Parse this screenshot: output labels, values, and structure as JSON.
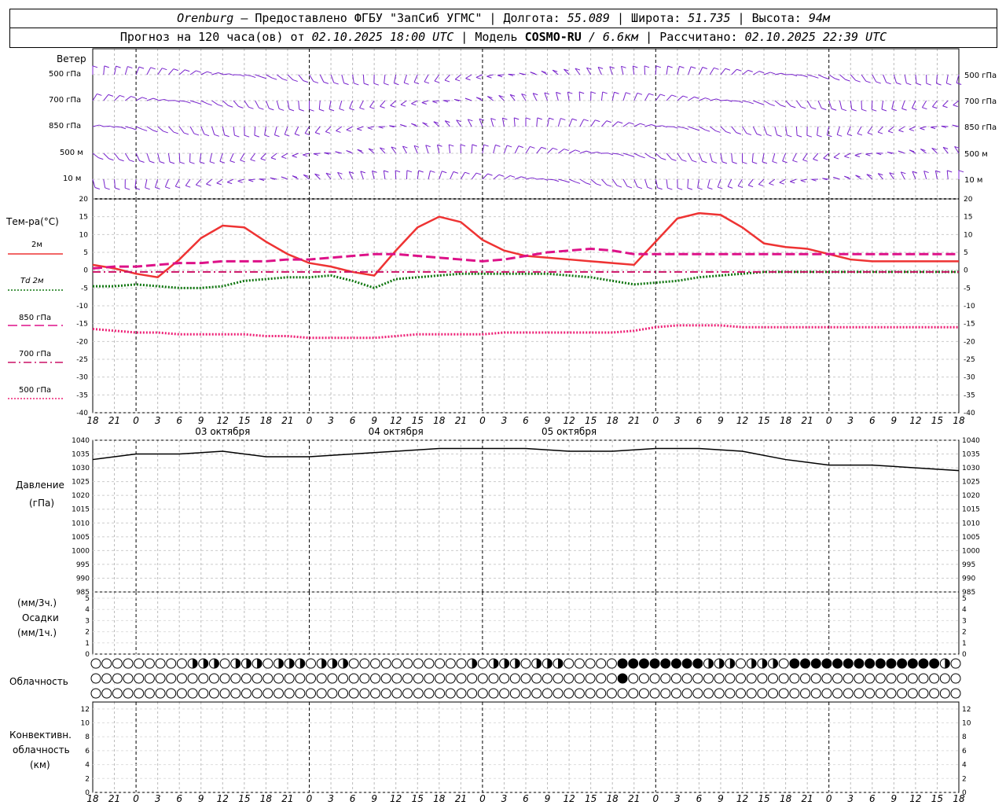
{
  "header": {
    "station": "Orenburg",
    "provider": "— Предоставлено ФГБУ \"ЗапСиб УГМС\"",
    "lon_label": "Долгота:",
    "lon": "55.089",
    "lat_label": "Широта:",
    "lat": "51.735",
    "alt_label": "Высота:",
    "alt": "94м",
    "forecast_label": "Прогноз на 120 часа(ов) от",
    "forecast_start": "02.10.2025 18:00 UTC",
    "model_label": "Модель",
    "model_name": "COSMO-RU",
    "model_res": "/ 6.6км",
    "computed_label": "Рассчитано:",
    "computed_at": "02.10.2025 22:39 UTC"
  },
  "wind_panel": {
    "title": "Ветер",
    "levels": [
      "500 гПа",
      "700 гПа",
      "850 гПа",
      "500 м",
      "10 м"
    ]
  },
  "temp_panel": {
    "title": "Тем-ра(°C)",
    "legend": [
      {
        "label": "2м",
        "color": "#ee3333",
        "style": "solid"
      },
      {
        "label": "Td 2м",
        "color": "#117711",
        "style": "dotted"
      },
      {
        "label": "850 гПа",
        "color": "#dd1188",
        "style": "dashed"
      },
      {
        "label": "700 гПа",
        "color": "#cc1166",
        "style": "dashdot"
      },
      {
        "label": "500 гПа",
        "color": "#ee2277",
        "style": "dotted"
      }
    ]
  },
  "pressure_panel": {
    "title": "Давление",
    "unit": "(гПа)"
  },
  "precip_panel": {
    "unit_top": "(мм/3ч.)",
    "title": "Осадки",
    "unit_bottom": "(мм/1ч.)"
  },
  "cloud_panel": {
    "title": "Облачность"
  },
  "conv_panel": {
    "line1": "Конвективн.",
    "line2": "облачность",
    "line3": "(км)"
  },
  "time_axis": {
    "hour_labels": [
      "18",
      "21",
      "0",
      "3",
      "6",
      "9",
      "12",
      "15",
      "18",
      "21",
      "0",
      "3",
      "6",
      "9",
      "12",
      "15",
      "18",
      "21",
      "0",
      "3",
      "6",
      "9",
      "12",
      "15",
      "18",
      "21",
      "0"
    ],
    "date_labels": [
      "03 октября",
      "04 октября",
      "05 октября"
    ]
  },
  "chart_data": [
    {
      "type": "line",
      "title": "Тем-ра(°C)",
      "x": [
        0,
        3,
        6,
        9,
        12,
        15,
        18,
        21,
        24,
        27,
        30,
        33,
        36,
        39,
        42,
        45,
        48,
        51,
        54,
        57,
        60,
        63,
        66,
        69,
        72,
        75,
        78,
        81,
        84,
        87,
        90,
        93,
        96,
        99,
        102,
        105,
        108,
        111,
        114,
        117,
        120
      ],
      "ylim": [
        -40,
        20
      ],
      "yticks": [
        20,
        15,
        10,
        5,
        0,
        -5,
        -10,
        -15,
        -20,
        -25,
        -30,
        -35,
        -40
      ],
      "series": [
        {
          "name": "2м",
          "color": "#ee3333",
          "values": [
            1.5,
            0.5,
            -1,
            -2,
            3,
            9,
            12.5,
            12,
            8,
            4.5,
            2,
            1,
            -0.5,
            -1.5,
            5.5,
            12,
            15,
            13.5,
            8.5,
            5.5,
            4,
            3.5,
            3,
            2.5,
            2,
            1.5,
            8,
            14.5,
            16,
            15.5,
            12,
            7.5,
            6.5,
            6,
            4.5,
            3,
            2.5,
            2.5,
            2.5,
            2.5,
            2.5
          ]
        },
        {
          "name": "Td 2м",
          "color": "#117711",
          "values": [
            -4.5,
            -4.5,
            -4,
            -4.5,
            -5,
            -5,
            -4.5,
            -3,
            -2.5,
            -2,
            -2,
            -1.5,
            -3,
            -5,
            -2.5,
            -2,
            -1.5,
            -1,
            -1,
            -1,
            -1,
            -1,
            -1.5,
            -2,
            -3,
            -4,
            -3.5,
            -3,
            -2,
            -1.5,
            -1,
            -0.5,
            -0.5,
            -0.5,
            -0.5,
            -0.5,
            -0.5,
            -0.5,
            -0.5,
            -0.5,
            -0.5
          ]
        },
        {
          "name": "850 гПа",
          "color": "#dd1188",
          "values": [
            0.5,
            1,
            1,
            1.5,
            2,
            2,
            2.5,
            2.5,
            2.5,
            3,
            3,
            3.5,
            4,
            4.5,
            4.5,
            4,
            3.5,
            3,
            2.5,
            3,
            4,
            5,
            5.5,
            6,
            5.5,
            4.5,
            4.5,
            4.5,
            4.5,
            4.5,
            4.5,
            4.5,
            4.5,
            4.5,
            4.5,
            4.5,
            4.5,
            4.5,
            4.5,
            4.5,
            4.5
          ]
        },
        {
          "name": "700 гПа",
          "color": "#cc1166",
          "values": [
            -0.5,
            -0.5,
            -0.5,
            -0.5,
            -0.5,
            -0.5,
            -0.5,
            -0.5,
            -0.5,
            -0.5,
            -0.5,
            -0.5,
            -0.5,
            -0.5,
            -0.5,
            -0.5,
            -0.5,
            -0.5,
            -0.5,
            -0.5,
            -0.5,
            -0.5,
            -0.5,
            -0.5,
            -0.5,
            -0.5,
            -0.5,
            -0.5,
            -0.5,
            -0.5,
            -0.5,
            -0.5,
            -0.5,
            -0.5,
            -0.5,
            -0.5,
            -0.5,
            -0.5,
            -0.5,
            -0.5,
            -0.5
          ]
        },
        {
          "name": "500 гПа",
          "color": "#ee2277",
          "values": [
            -16.5,
            -17,
            -17.5,
            -17.5,
            -18,
            -18,
            -18,
            -18,
            -18.5,
            -18.5,
            -19,
            -19,
            -19,
            -19,
            -18.5,
            -18,
            -18,
            -18,
            -18,
            -17.5,
            -17.5,
            -17.5,
            -17.5,
            -17.5,
            -17.5,
            -17,
            -16,
            -15.5,
            -15.5,
            -15.5,
            -16,
            -16,
            -16,
            -16,
            -16,
            -16,
            -16,
            -16,
            -16,
            -16,
            -16
          ]
        }
      ]
    },
    {
      "type": "line",
      "title": "Давление",
      "x": [
        0,
        6,
        12,
        18,
        24,
        30,
        36,
        42,
        48,
        54,
        60,
        66,
        72,
        78,
        84,
        90,
        96,
        102,
        108,
        114,
        120
      ],
      "ylim": [
        985,
        1040
      ],
      "yticks": [
        1040,
        1035,
        1030,
        1025,
        1020,
        1015,
        1010,
        1005,
        1000,
        995,
        990,
        985
      ],
      "series": [
        {
          "name": "Давление",
          "color": "#000000",
          "values": [
            1033,
            1035,
            1035,
            1036,
            1034,
            1034,
            1035,
            1036,
            1037,
            1037,
            1037,
            1036,
            1036,
            1037,
            1037,
            1036,
            1033,
            1031,
            1031,
            1030,
            1029
          ]
        }
      ]
    },
    {
      "type": "bar",
      "title": "Осадки",
      "ylim": [
        0,
        5
      ],
      "yticks": [
        5,
        4,
        3,
        2,
        1,
        0
      ],
      "values": []
    },
    {
      "type": "bar",
      "title": "Конвективн. облачность",
      "ylim": [
        0,
        13
      ],
      "yticks": [
        12,
        10,
        8,
        6,
        4,
        2,
        0
      ],
      "values": []
    }
  ]
}
